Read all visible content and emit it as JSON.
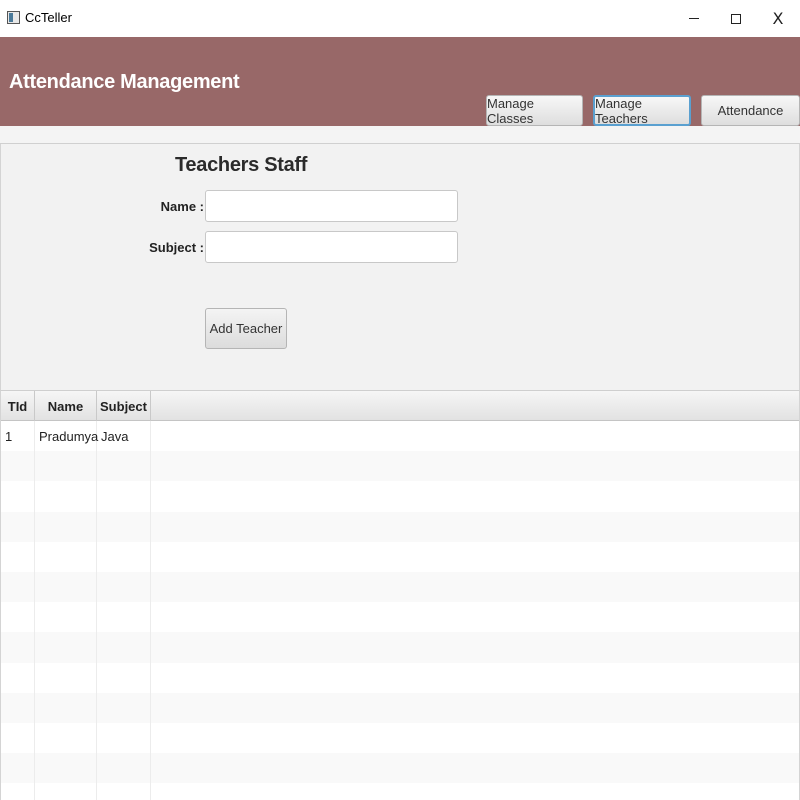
{
  "window": {
    "title": "CcTeller",
    "icon": "app-window-icon",
    "controls": {
      "minimize": "minimize-icon",
      "maximize": "maximize-icon",
      "close_symbol": "X"
    }
  },
  "header": {
    "title": "Attendance Management",
    "background_color": "#986868",
    "nav": {
      "manage_classes": "Manage Classes",
      "manage_teachers": "Manage Teachers",
      "attendance": "Attendance"
    }
  },
  "form": {
    "title": "Teachers Staff",
    "name_label": "Name :",
    "name_value": "",
    "subject_label": "Subject :",
    "subject_value": "",
    "add_button": "Add Teacher"
  },
  "table": {
    "columns": [
      "TId",
      "Name",
      "Subject"
    ],
    "rows": [
      {
        "tid": "1",
        "name": "Pradumya",
        "subject": "Java"
      }
    ]
  }
}
